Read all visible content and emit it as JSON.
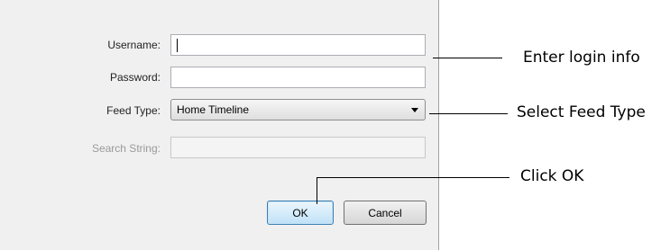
{
  "form": {
    "username_label": "Username:",
    "username_value": "",
    "password_label": "Password:",
    "password_value": "",
    "feed_type_label": "Feed Type:",
    "feed_type_selected": "Home Timeline",
    "search_label": "Search String:",
    "search_value": ""
  },
  "buttons": {
    "ok": "OK",
    "cancel": "Cancel"
  },
  "callouts": {
    "login": "Enter login info",
    "feed": "Select Feed Type",
    "ok": "Click OK"
  }
}
